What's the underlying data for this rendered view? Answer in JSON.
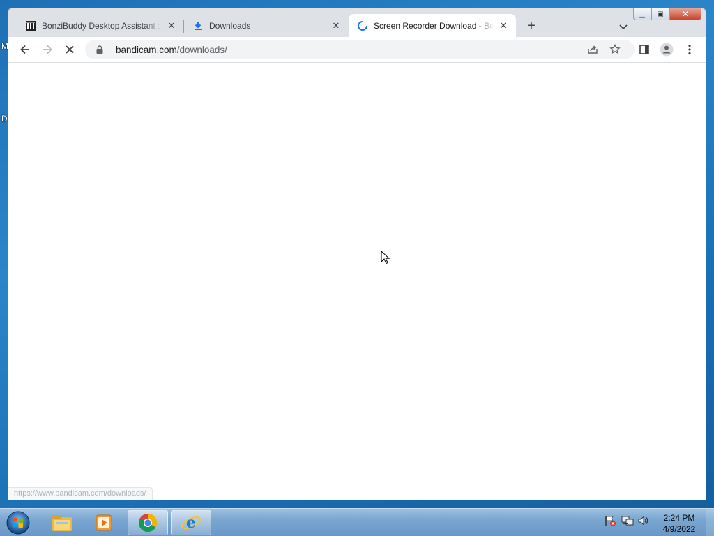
{
  "desktop": {
    "letters": [
      "M",
      "D"
    ]
  },
  "browser": {
    "tabs": [
      {
        "title": "BonziBuddy Desktop Assistant : B",
        "icon": "archive-icon",
        "active": false
      },
      {
        "title": "Downloads",
        "icon": "download-icon",
        "active": false
      },
      {
        "title": "Screen Recorder Download - Best",
        "icon": "loading-spinner-icon",
        "active": true
      }
    ],
    "address": {
      "host": "bandicam.com",
      "path": "/downloads/"
    },
    "status_url": "https://www.bandicam.com/downloads/"
  },
  "taskbar": {
    "pinned": [
      "explorer-icon",
      "media-player-icon",
      "chrome-icon",
      "internet-explorer-icon"
    ],
    "clock": {
      "time": "2:24 PM",
      "date": "4/9/2022"
    }
  },
  "colors": {
    "accent": "#1a73e8",
    "tab_strip": "#dee1e6"
  }
}
